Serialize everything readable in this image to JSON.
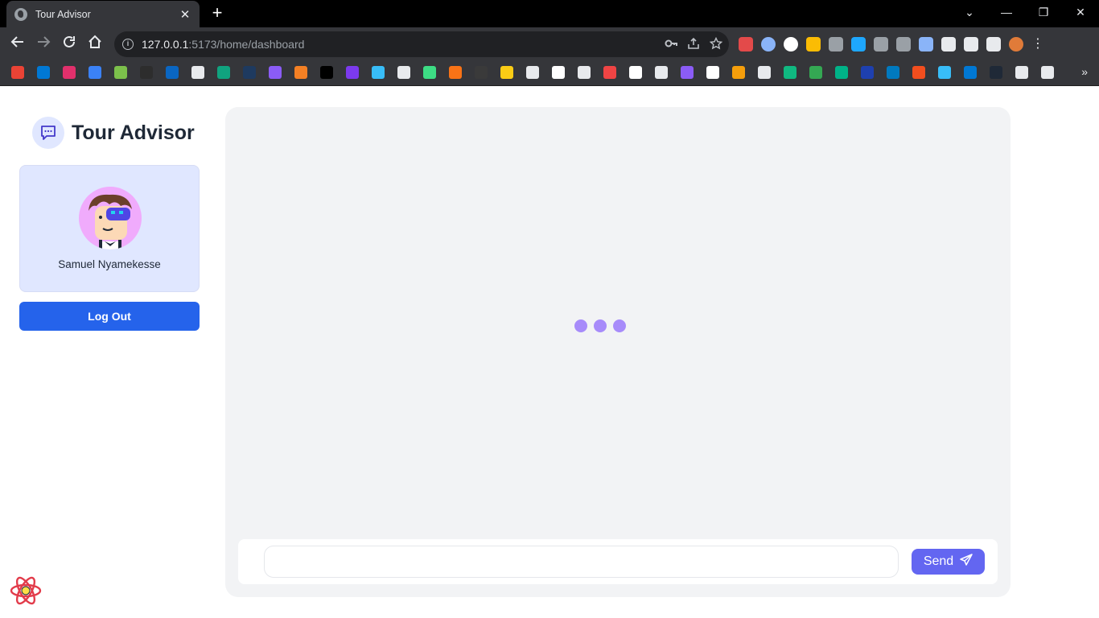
{
  "browser": {
    "tab_title": "Tour Advisor",
    "close_glyph": "✕",
    "newtab_glyph": "+",
    "url_host": "127.0.0.1",
    "url_rest": ":5173/home/dashboard",
    "window_controls": {
      "minimize": "—",
      "restore": "❐",
      "close": "✕",
      "tab_search": "⌄"
    },
    "more_bookmarks": "»",
    "extension_colors": [
      "#e34a4a",
      "#8ab4f8",
      "#ffffff",
      "#fbbc04",
      "#9aa0a6",
      "#1ea7fd",
      "#9aa0a6",
      "#9aa0a6",
      "#8ab4f8",
      "#e8eaed",
      "#e8eaed",
      "#e8eaed",
      "#e8eaed",
      "#e07b39"
    ],
    "bookmark_colors": [
      "#ea4335",
      "#0078d4",
      "#e1306c",
      "#3b82f6",
      "#7cc04b",
      "#2d2d2d",
      "#0a66c2",
      "#e8eaed",
      "#10a37f",
      "#1e3a5f",
      "#8b5cf6",
      "#f48024",
      "#000000",
      "#7c3aed",
      "#38bdf8",
      "#e8eaed",
      "#3ddc84",
      "#f97316",
      "#3a3a3a",
      "#facc15",
      "#e8eaed",
      "#ffffff",
      "#e8eaed",
      "#ef4444",
      "#ffffff",
      "#e8eaed",
      "#8b5cf6",
      "#ffffff",
      "#f59e0b",
      "#e8eaed",
      "#10b981",
      "#34a853",
      "#00b388",
      "#1e40af",
      "#0079bf",
      "#f24e1e",
      "#38bdf8",
      "#0078d4",
      "#1f2937",
      "#e8eaed",
      "#e8eaed"
    ]
  },
  "sidebar": {
    "brand_title": "Tour Advisor",
    "user_name": "Samuel Nyamekesse",
    "logout_label": "Log Out"
  },
  "chat": {
    "input_value": "",
    "input_placeholder": "",
    "send_label": "Send",
    "loading": true
  },
  "colors": {
    "primary": "#2563eb",
    "send": "#6366f1",
    "loader": "#a78bfa",
    "card": "#e0e7ff",
    "panel": "#f2f3f5"
  }
}
